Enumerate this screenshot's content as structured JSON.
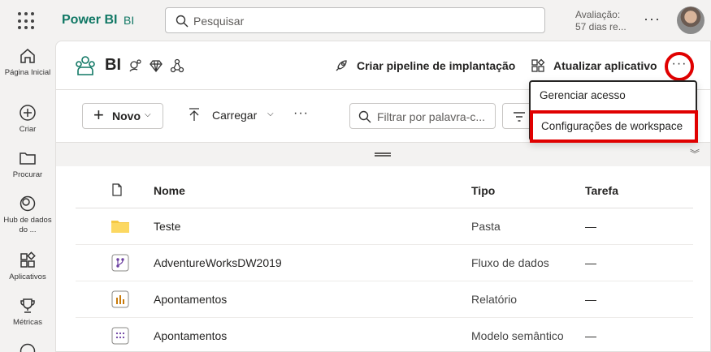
{
  "app": {
    "brand": "Power BI",
    "workspace_short": "BI"
  },
  "search": {
    "placeholder": "Pesquisar"
  },
  "trial": {
    "line1": "Avaliação:",
    "line2": "57 dias re..."
  },
  "nav": [
    {
      "label": "Página Inicial",
      "icon": "home-icon"
    },
    {
      "label": "Criar",
      "icon": "create-icon"
    },
    {
      "label": "Procurar",
      "icon": "folder-icon"
    },
    {
      "label": "Hub de dados do ...",
      "icon": "data-hub-icon"
    },
    {
      "label": "Aplicativos",
      "icon": "apps-icon"
    },
    {
      "label": "Métricas",
      "icon": "trophy-icon"
    }
  ],
  "workspace": {
    "title": "BI",
    "pipeline_label": "Criar pipeline de implantação",
    "update_app_label": "Atualizar aplicativo"
  },
  "toolbar": {
    "new_label": "Novo",
    "upload_label": "Carregar",
    "filter_placeholder": "Filtrar por palavra-c..."
  },
  "table": {
    "headers": {
      "name": "Nome",
      "type": "Tipo",
      "task": "Tarefa"
    },
    "rows": [
      {
        "icon": "folder-icon",
        "name": "Teste",
        "type": "Pasta",
        "task": "—"
      },
      {
        "icon": "dataflow-icon",
        "name": "AdventureWorksDW2019",
        "type": "Fluxo de dados",
        "task": "—"
      },
      {
        "icon": "report-icon",
        "name": "Apontamentos",
        "type": "Relatório",
        "task": "—"
      },
      {
        "icon": "semantic-model-icon",
        "name": "Apontamentos",
        "type": "Modelo semântico",
        "task": "—"
      }
    ]
  },
  "menu": {
    "items": [
      "Gerenciar acesso",
      "Configurações de workspace"
    ]
  },
  "colors": {
    "brand": "#117865",
    "highlight": "#e00000"
  }
}
